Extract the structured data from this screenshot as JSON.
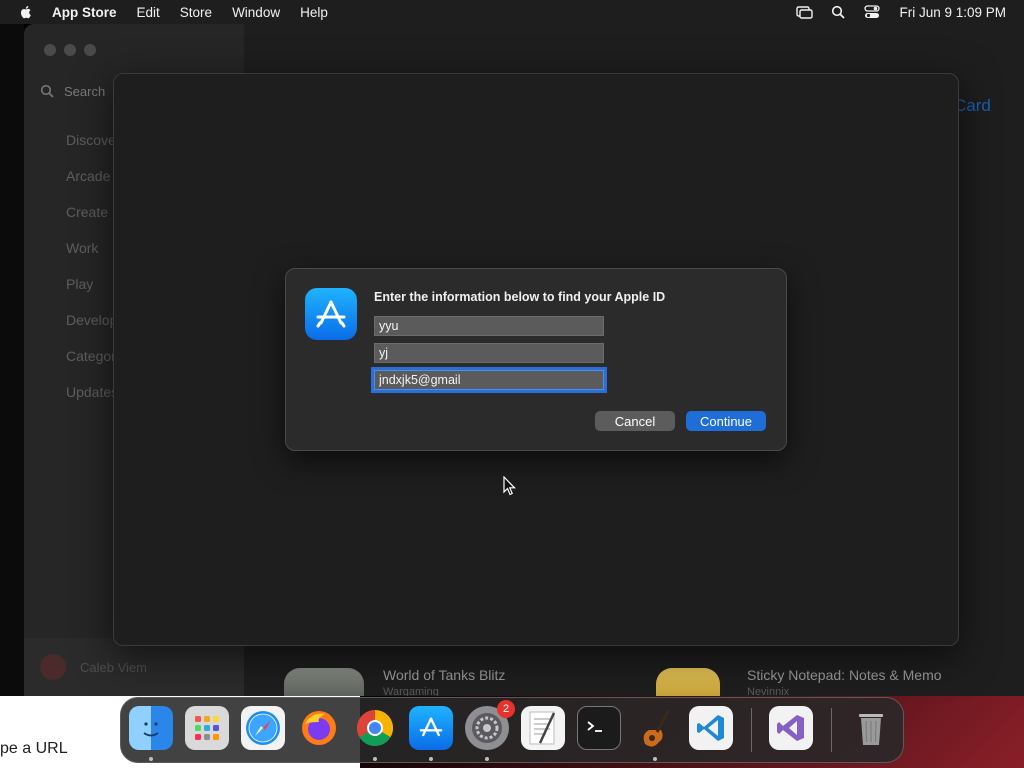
{
  "menubar": {
    "app_name": "App Store",
    "items": [
      "Edit",
      "Store",
      "Window",
      "Help"
    ],
    "clock": "Fri Jun 9  1:09 PM"
  },
  "sidebar": {
    "search_placeholder": "Search",
    "items": [
      "Discover",
      "Arcade",
      "Create",
      "Work",
      "Play",
      "Develop",
      "Categories",
      "Updates"
    ],
    "user_name": "Caleb Viem"
  },
  "main": {
    "link_text": "Card",
    "apps": [
      {
        "title": "World of Tanks Blitz",
        "subtitle": "Wargaming"
      },
      {
        "title": "Sticky Notepad: Notes & Memo",
        "subtitle": "Nevinnix"
      }
    ]
  },
  "dialog": {
    "title": "Enter the information below to find your Apple ID",
    "fields": {
      "first_name": "yyu",
      "last_name": "yj",
      "email": "jndxjk5@gmail"
    },
    "cancel_label": "Cancel",
    "continue_label": "Continue"
  },
  "browser": {
    "url_placeholder": "pe a URL"
  },
  "dock": {
    "apps": [
      "Finder",
      "Launchpad",
      "Safari",
      "Firefox",
      "Chrome",
      "App Store",
      "System Settings",
      "TextEdit",
      "Terminal",
      "GarageBand",
      "Visual Studio Code",
      "Visual Studio",
      "Trash"
    ],
    "settings_badge": "2"
  },
  "colors": {
    "accent": "#1f6ed8",
    "focus_ring": "#2a6fd6",
    "badge": "#e5322d"
  }
}
